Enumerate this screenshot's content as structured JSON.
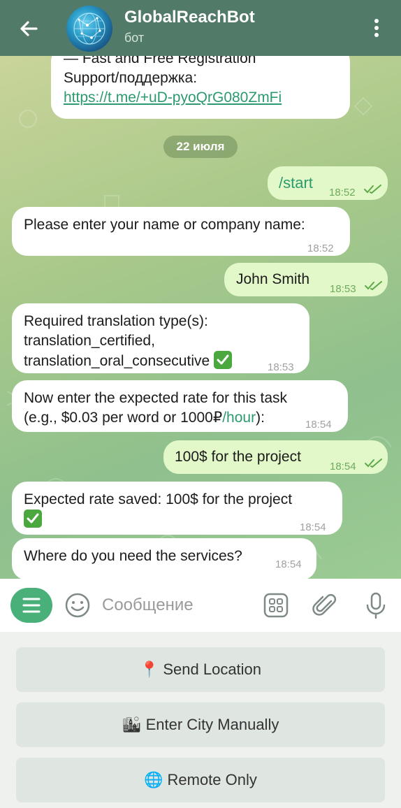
{
  "header": {
    "title": "GlobalReachBot",
    "subtitle": "бот"
  },
  "messages": {
    "top_partial": {
      "line1": "— Fast and Free Registration",
      "line2": "Support/поддержка:",
      "link": "https://t.me/+uD-pyoQrG080ZmFi"
    },
    "date_pill": "22 июля",
    "m1": {
      "text": "/start",
      "time": "18:52"
    },
    "m2": {
      "text": "Please enter your name or company name:",
      "time": "18:52"
    },
    "m3": {
      "text": "John Smith",
      "time": "18:53"
    },
    "m4": {
      "line1": "Required translation type(s):",
      "line2": "translation_certified,",
      "line3": "translation_oral_consecutive",
      "time": "18:53"
    },
    "m5": {
      "line1": "Now enter the expected rate for this task",
      "line2_a": "(e.g., $0.03 per word or 1000₽",
      "line2_b": "/hour",
      "line2_c": "):",
      "time": "18:54"
    },
    "m6": {
      "text": "100$ for the project",
      "time": "18:54"
    },
    "m7": {
      "text": "Expected rate saved: 100$ for the project",
      "time": "18:54"
    },
    "m8": {
      "text": "Where do you need the services?",
      "time": "18:54"
    }
  },
  "input": {
    "placeholder": "Сообщение"
  },
  "keyboard": {
    "send_location": {
      "emoji": "📍",
      "label": "Send Location"
    },
    "enter_city": {
      "emoji": "🏙",
      "label": "Enter City Manually"
    },
    "remote_only": {
      "emoji": "🌐",
      "label": "Remote Only"
    }
  },
  "colors": {
    "header_bg": "#527a69",
    "outgoing_bubble": "#e3f8c9",
    "incoming_bubble": "#ffffff",
    "accent_green": "#49b07a",
    "check_green": "#4aa83f"
  }
}
